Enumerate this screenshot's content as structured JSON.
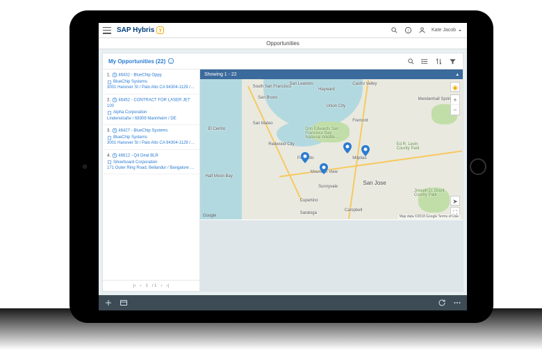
{
  "header": {
    "brand": "SAP Hybris",
    "user_name": "Kate Jacob"
  },
  "page": {
    "title": "Opportunities"
  },
  "panel": {
    "title": "My Opportunities",
    "count": "(22)"
  },
  "map": {
    "status": "Showing 1 - 22",
    "google_label": "Google",
    "attribution": "Map data ©2018 Google   Terms of Use",
    "cities": {
      "ssf": "South San Francisco",
      "sanbruno": "San Bruno",
      "sanmateo": "San Mateo",
      "redwood": "Redwood City",
      "paloalto": "Palo Alto",
      "mtview": "Mountain View",
      "sunnyvale": "Sunnyvale",
      "cupertino": "Cupertino",
      "saratoga": "Saratoga",
      "campbell": "Campbell",
      "sanjose": "San Jose",
      "milpitas": "Milpitas",
      "fremont": "Fremont",
      "unioncity": "Union City",
      "hayward": "Hayward",
      "castro": "Castro Valley",
      "sanleandro": "San Leandro",
      "elcerrito": "El Cerrito",
      "mendenhall": "Mendenhall Springs",
      "edhenry": "Ed R. Levin County Park",
      "grant": "Joseph D. Grant County Park",
      "refuge": "Don Edwards San Francisco Bay National Wildlife…",
      "halfmoon": "Half Moon Bay"
    }
  },
  "list": {
    "items": [
      {
        "num": "1.",
        "id": "46432",
        "title": "BlueChip Oppy",
        "company": "BlueChip Systems",
        "addr": "3001 Hanover St / Palo Alto CA 94304-1129 / …"
      },
      {
        "num": "2.",
        "id": "46452",
        "title": "CONTRACT FOR LASER JET 100",
        "company": "Alpha Corporation",
        "addr": "Lindenstraße / 68309 Mannheim / DE"
      },
      {
        "num": "3.",
        "id": "46427",
        "title": "BlueChip Systems",
        "company": "BlueChip Systems",
        "addr": "3001 Hanover St / Palo Alto CA 94304-1129 / …"
      },
      {
        "num": "4.",
        "id": "46612",
        "title": "Q4 Deal BLR",
        "company": "Silverboard Corporation",
        "addr": "171 Outer Ring Road, Bellandur / Bangalore 5…"
      }
    ]
  },
  "pager": {
    "page": "1",
    "total": "/ 1"
  },
  "zoom": {
    "plus": "+",
    "minus": "−"
  }
}
